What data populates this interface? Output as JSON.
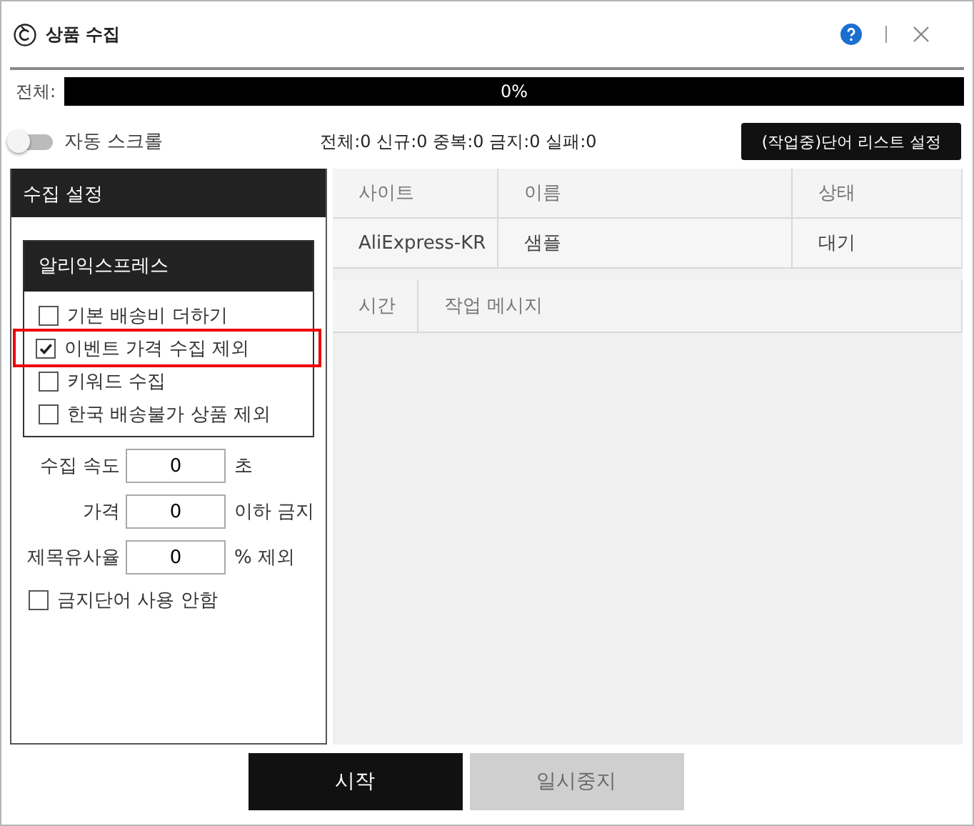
{
  "window": {
    "title": "상품 수집"
  },
  "progress": {
    "label": "전체:",
    "level": 0,
    "reading": "0%"
  },
  "auto_scroll": {
    "label": "자동 스크롤",
    "on": false
  },
  "stats": "전체:0 신규:0 중복:0 금지:0 실패:0",
  "word_list_button": "(작업중)단어 리스트 설정",
  "settings": {
    "title": "수집 설정",
    "site": {
      "title": "알리익스프레스",
      "options": [
        {
          "label": "기본 배송비 더하기",
          "checked": false,
          "highlighted": false
        },
        {
          "label": "이벤트 가격 수집 제외",
          "checked": true,
          "highlighted": true
        },
        {
          "label": "키워드 수집",
          "checked": false,
          "highlighted": false
        },
        {
          "label": "한국 배송불가 상품 제외",
          "checked": false,
          "highlighted": false
        }
      ]
    },
    "fields": [
      {
        "label": "수집 속도",
        "value": "0",
        "unit": "초"
      },
      {
        "label": "가격",
        "value": "0",
        "unit": "이하 금지"
      },
      {
        "label": "제목유사율",
        "value": "0",
        "unit": "% 제외"
      }
    ],
    "ban_words": {
      "label": "금지단어 사용 안함",
      "checked": false
    }
  },
  "sites_table": {
    "columns": [
      "사이트",
      "이름",
      "상태"
    ],
    "rows": [
      [
        "AliExpress-KR",
        "샘플",
        "대기"
      ]
    ]
  },
  "log_table": {
    "columns": [
      "시간",
      "작업 메시지"
    ]
  },
  "buttons": [
    {
      "label": "시작",
      "disabled": false
    },
    {
      "label": "일시중지",
      "disabled": true
    }
  ]
}
